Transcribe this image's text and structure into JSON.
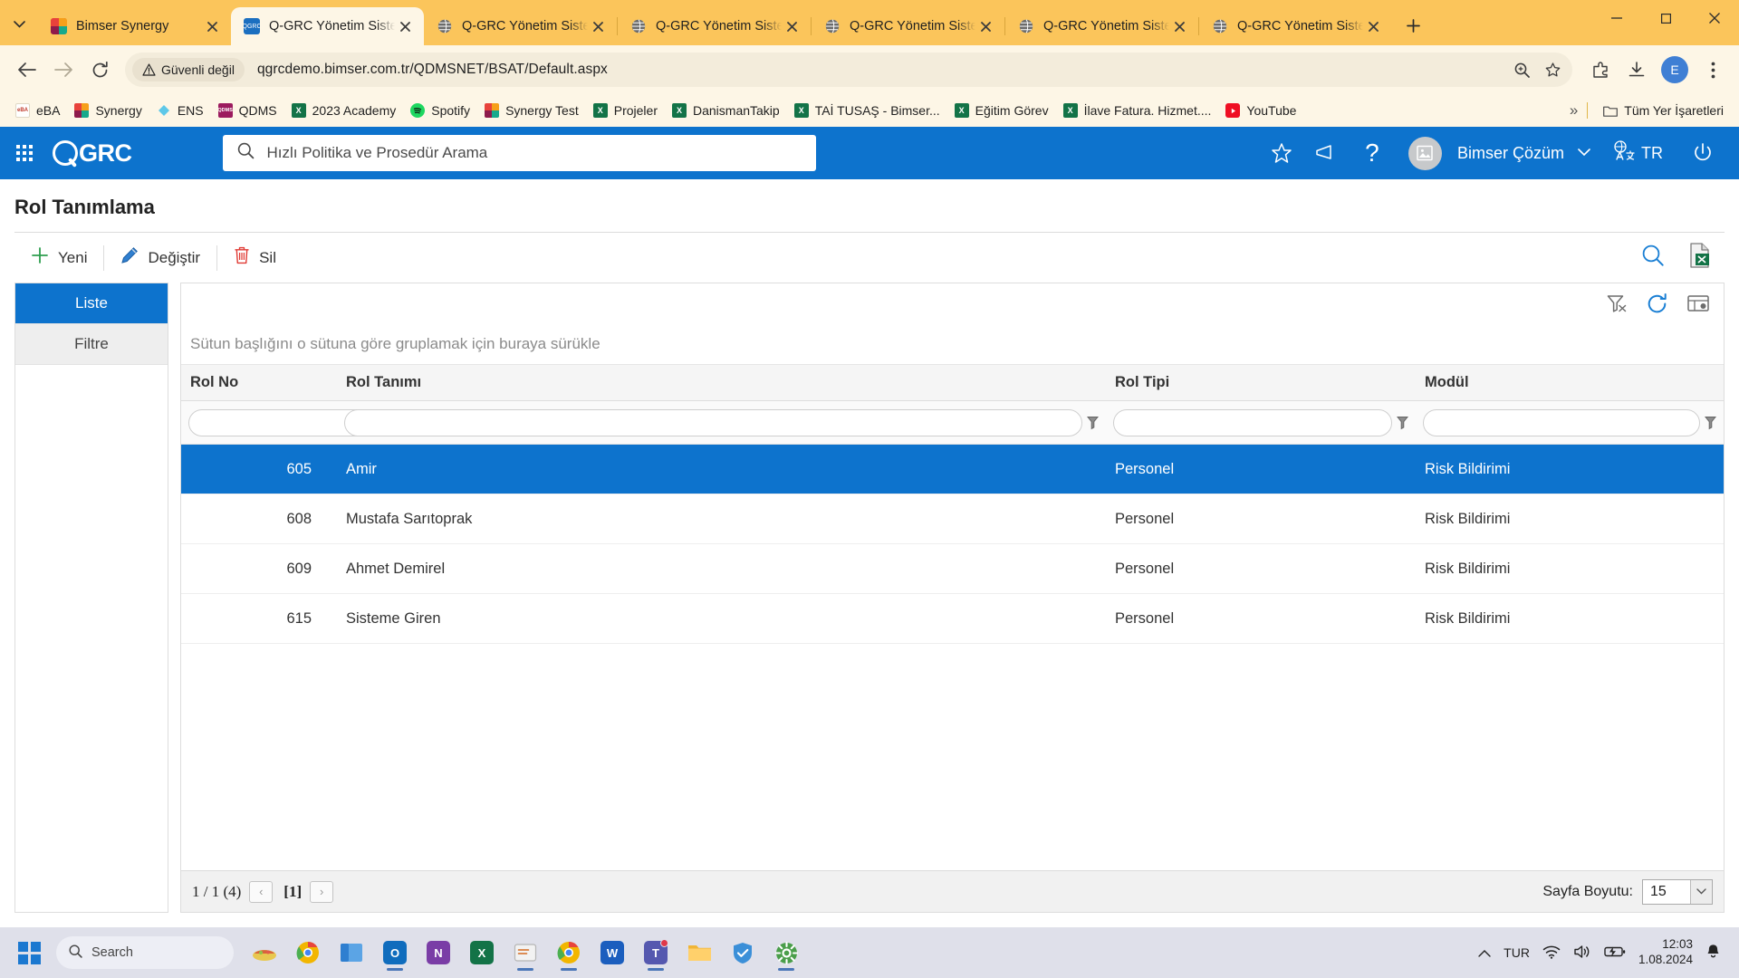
{
  "browser": {
    "tabs": [
      {
        "title": "Bimser Synergy",
        "favicon": "bimser-icon",
        "active": false
      },
      {
        "title": "Q-GRC Yönetim Siste",
        "favicon": "qgrc-icon",
        "active": true
      },
      {
        "title": "Q-GRC Yönetim Siste",
        "favicon": "globe-icon",
        "active": false
      },
      {
        "title": "Q-GRC Yönetim Siste",
        "favicon": "globe-icon",
        "active": false
      },
      {
        "title": "Q-GRC Yönetim Siste",
        "favicon": "globe-icon",
        "active": false
      },
      {
        "title": "Q-GRC Yönetim Siste",
        "favicon": "globe-icon",
        "active": false
      },
      {
        "title": "Q-GRC Yönetim Siste",
        "favicon": "globe-icon",
        "active": false
      }
    ],
    "security_label": "Güvenli değil",
    "url": "qgrcdemo.bimser.com.tr/QDMSNET/BSAT/Default.aspx",
    "profile_initial": "E",
    "bookmarks": [
      {
        "label": "eBA",
        "icon": "eba-icon",
        "color": "#ffffff"
      },
      {
        "label": "Synergy",
        "icon": "bimser-icon",
        "color": "#8e1b4b"
      },
      {
        "label": "ENS",
        "icon": "ens-icon",
        "color": "#4fc3e8"
      },
      {
        "label": "QDMS",
        "icon": "qdms-icon",
        "color": "#9c1b5e"
      },
      {
        "label": "2023 Academy",
        "icon": "excel-icon",
        "color": "#137347"
      },
      {
        "label": "Spotify",
        "icon": "spotify-icon",
        "color": "#1ed760"
      },
      {
        "label": "Synergy Test",
        "icon": "bimser-icon",
        "color": "#8e1b4b"
      },
      {
        "label": "Projeler",
        "icon": "excel-icon",
        "color": "#137347"
      },
      {
        "label": "DanismanTakip",
        "icon": "excel-icon",
        "color": "#137347"
      },
      {
        "label": "TAİ TUSAŞ - Bimser...",
        "icon": "excel-icon",
        "color": "#137347"
      },
      {
        "label": "Eğitim Görev",
        "icon": "excel-icon",
        "color": "#137347"
      },
      {
        "label": "İlave Fatura. Hizmet....",
        "icon": "excel-icon",
        "color": "#137347"
      },
      {
        "label": "YouTube",
        "icon": "youtube-icon",
        "color": "#ef0f23"
      }
    ],
    "bookmarks_overflow": "»",
    "all_bookmarks_label": "Tüm Yer İşaretleri"
  },
  "app": {
    "brand": "GRC",
    "brand_mark": "Q",
    "search_placeholder": "Hızlı Politika ve Prosedür Arama",
    "search_value": "",
    "username": "Bimser Çözüm",
    "language": "TR",
    "accent_color": "#0d73cd"
  },
  "page": {
    "title": "Rol Tanımlama",
    "actions": [
      {
        "label": "Yeni",
        "icon": "plus-icon"
      },
      {
        "label": "Değiştir",
        "icon": "pencil-icon"
      },
      {
        "label": "Sil",
        "icon": "trash-icon"
      }
    ]
  },
  "leftnav": {
    "items": [
      {
        "label": "Liste",
        "active": true
      },
      {
        "label": "Filtre",
        "active": false
      }
    ]
  },
  "grid": {
    "group_hint": "Sütun başlığını o sütuna göre gruplamak için buraya sürükle",
    "columns": [
      "Rol No",
      "Rol Tanımı",
      "Rol Tipi",
      "Modül"
    ],
    "filters": {
      "rol_no": "",
      "rol_tanimi": "",
      "rol_tipi": "",
      "modul": ""
    },
    "rows": [
      {
        "rol_no": "605",
        "rol_tanimi": "Amir",
        "rol_tipi": "Personel",
        "modul": "Risk Bildirimi",
        "selected": true
      },
      {
        "rol_no": "608",
        "rol_tanimi": "Mustafa Sarıtoprak",
        "rol_tipi": "Personel",
        "modul": "Risk Bildirimi",
        "selected": false
      },
      {
        "rol_no": "609",
        "rol_tanimi": "Ahmet Demirel",
        "rol_tipi": "Personel",
        "modul": "Risk Bildirimi",
        "selected": false
      },
      {
        "rol_no": "615",
        "rol_tanimi": "Sisteme Giren",
        "rol_tipi": "Personel",
        "modul": "Risk Bildirimi",
        "selected": false
      }
    ],
    "footer": {
      "page_info": "1 / 1 (4)",
      "prev": "‹",
      "current_page": "[1]",
      "next": "›",
      "page_size_label": "Sayfa Boyutu:",
      "page_size_value": "15"
    }
  },
  "taskbar": {
    "search_placeholder": "Search",
    "language": "TUR",
    "time": "12:03",
    "date": "1.08.2024"
  }
}
